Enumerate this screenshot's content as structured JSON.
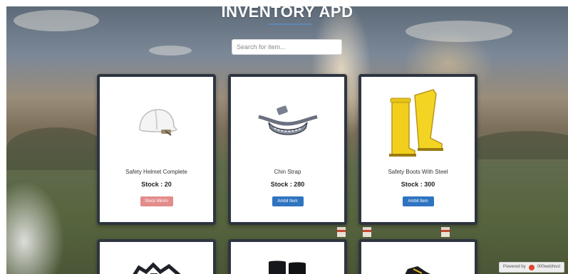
{
  "header": {
    "title": "INVENTORY APD"
  },
  "search": {
    "placeholder": "Search for item..."
  },
  "items": [
    {
      "name": "Safety Helmet Complete",
      "stock_label": "Stock : ",
      "stock_value": "20",
      "button": "Stock Minim",
      "icon": "helmet-icon"
    },
    {
      "name": "Chin Strap",
      "stock_label": "Stock : ",
      "stock_value": "280",
      "button": "Ambil Item",
      "icon": "chin-strap-icon"
    },
    {
      "name": "Safety Boots With Steel",
      "stock_label": "Stock : ",
      "stock_value": "300",
      "button": "Ambil Item",
      "icon": "yellow-boots-icon"
    }
  ],
  "more_items_icons": [
    "harness-icon",
    "black-boots-icon",
    "safety-shoe-icon"
  ],
  "footer": {
    "powered_by": "Powered by",
    "brand": "000webhost"
  },
  "colors": {
    "card_border": "#2e3540",
    "button_primary": "#2f74c0",
    "button_warning": "#e38c8c",
    "title_underline": "#5b8fd1"
  }
}
